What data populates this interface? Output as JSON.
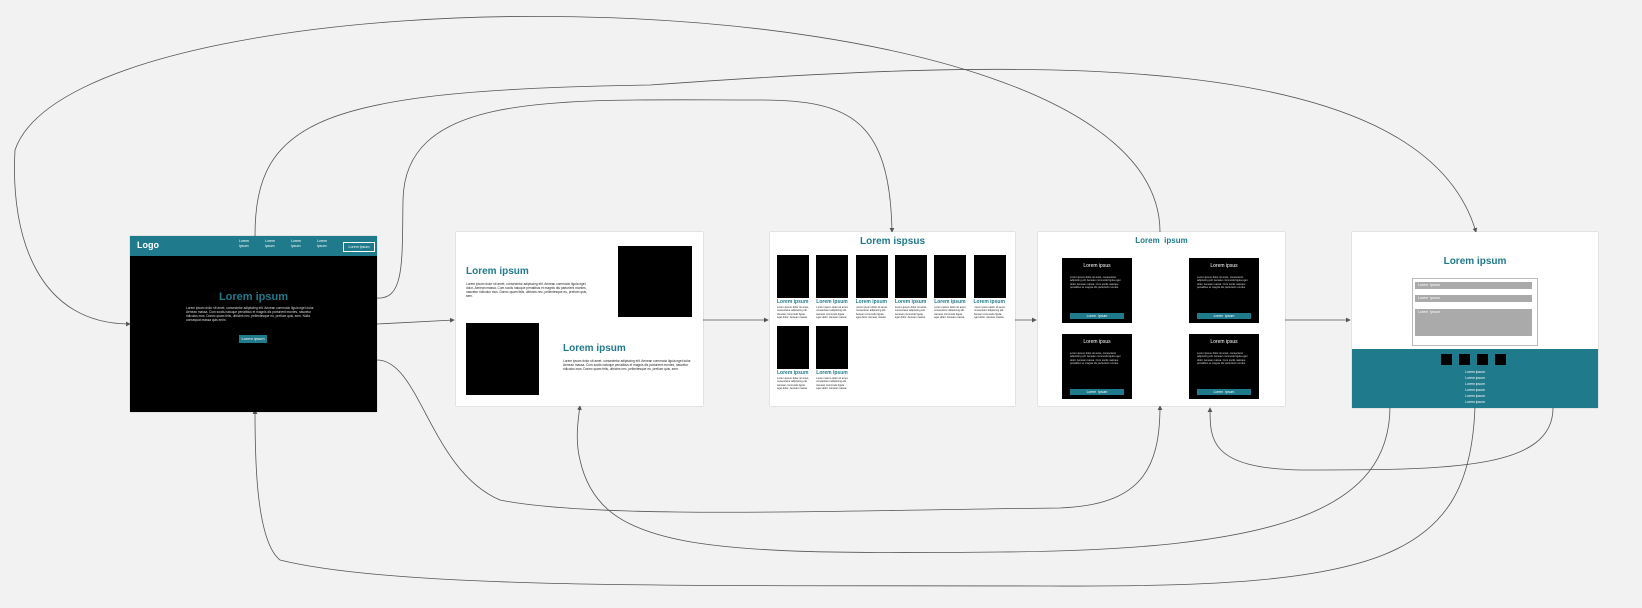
{
  "home": {
    "logo": "Logo",
    "nav_items": [
      "Lorem\nIpsum",
      "Lorem\nIpsum",
      "Lorem\nIpsum",
      "Lorem\nIpsum"
    ],
    "nav_button": "Lorem Ipsum",
    "title": "Lorem ipsum",
    "body": "Lorem ipsum dolor sit amet, consectetur adipiscing elit. Aenean commodo ligula eget dolor. Aenean massa. Cum sociis natoque penatibus et magnis dis parturient montes, nascetur ridiculus mus. Donec quam felis, ultricies nec, pellentesque eu, pretium quis, sem. Nulla consequat massa quis enim.",
    "button": "Lorem ipsum"
  },
  "about": {
    "title1": "Lorem ipsum",
    "body1": "Lorem ipsum dolor sit amet, consectetur adipiscing elit. Aenean commodo ligula eget dolor. Aenean massa. Cum sociis natoque penatibus et magnis dis parturient montes, nascetur ridiculus mus. Donec quam felis, ultricies nec, pellentesque eu, pretium quis, sem.",
    "title2": "Lorem ipsum",
    "body2": "Lorem ipsum dolor sit amet, consectetur adipiscing elit. Aenean commodo ligula eget dolor. Aenean massa. Cum sociis natoque penatibus et magnis dis parturient montes, nascetur ridiculus mus. Donec quam felis, ultricies nec, pellentesque eu, pretium quis, sem."
  },
  "gallery": {
    "title": "Lorem ispsus",
    "item_label": "Lorem ipsum",
    "item_text": "Lorem ipsum dolor sit amet, consectetur adipiscing elit. Aenean commodo ligula eget dolor. Aenean massa."
  },
  "services": {
    "title": "Lorem  ipsum",
    "card_title": "Lorem ipsus",
    "card_text": "Lorem ipsum dolor sit amet, consectetur adipiscing elit. Aenean commodo ligula eget dolor. Aenean massa. Cum sociis natoque penatibus et magnis dis parturient montes.",
    "card_button": "Lorem  Ipsum"
  },
  "contact": {
    "title": "Lorem ipsum",
    "field1": "Lorem  Ipsum",
    "field2": "Lorem  Ipsum",
    "field3": "Lorem  Ipsum",
    "footer_links": [
      "Lorem ipsum",
      "Lorem ipsum",
      "Lorem ipsum",
      "Lorem ipsum",
      "Lorem ipsum",
      "Lorem ipsum"
    ]
  },
  "colors": {
    "accent": "#1f7a8c",
    "background": "#f2f2f2",
    "dark": "#000000"
  }
}
